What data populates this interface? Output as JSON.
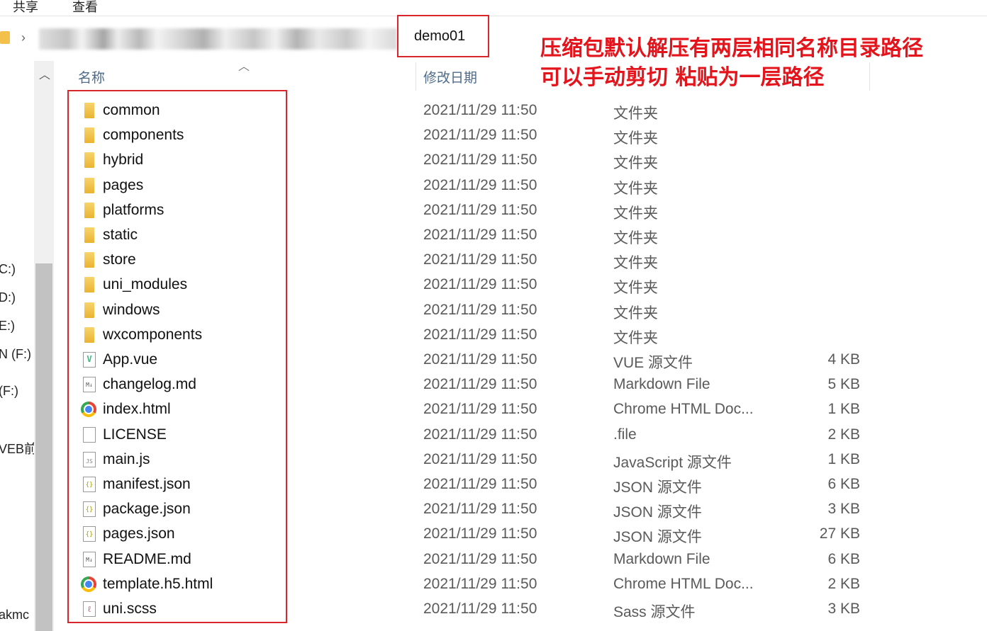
{
  "ribbon": {
    "share": "共享",
    "view": "查看"
  },
  "address": {
    "current_folder": "demo01"
  },
  "annotation": {
    "line1": "压缩包默认解压有两层相同名称目录路径",
    "line2": "可以手动剪切 粘贴为一层路径"
  },
  "nav": {
    "c": "C:)",
    "d": "D:)",
    "e": "E:)",
    "f1": "N (F:)",
    "f2": "(F:)",
    "web": "VEB前",
    "bottom": "akmc"
  },
  "columns": {
    "name": "名称",
    "date": "修改日期"
  },
  "files": [
    {
      "name": "common",
      "date": "2021/11/29 11:50",
      "type": "文件夹",
      "size": "",
      "icon": "folder-icon"
    },
    {
      "name": "components",
      "date": "2021/11/29 11:50",
      "type": "文件夹",
      "size": "",
      "icon": "folder-icon"
    },
    {
      "name": "hybrid",
      "date": "2021/11/29 11:50",
      "type": "文件夹",
      "size": "",
      "icon": "folder-icon"
    },
    {
      "name": "pages",
      "date": "2021/11/29 11:50",
      "type": "文件夹",
      "size": "",
      "icon": "folder-icon"
    },
    {
      "name": "platforms",
      "date": "2021/11/29 11:50",
      "type": "文件夹",
      "size": "",
      "icon": "folder-icon"
    },
    {
      "name": "static",
      "date": "2021/11/29 11:50",
      "type": "文件夹",
      "size": "",
      "icon": "folder-icon"
    },
    {
      "name": "store",
      "date": "2021/11/29 11:50",
      "type": "文件夹",
      "size": "",
      "icon": "folder-icon"
    },
    {
      "name": "uni_modules",
      "date": "2021/11/29 11:50",
      "type": "文件夹",
      "size": "",
      "icon": "folder-icon"
    },
    {
      "name": "windows",
      "date": "2021/11/29 11:50",
      "type": "文件夹",
      "size": "",
      "icon": "folder-icon"
    },
    {
      "name": "wxcomponents",
      "date": "2021/11/29 11:50",
      "type": "文件夹",
      "size": "",
      "icon": "folder-icon"
    },
    {
      "name": "App.vue",
      "date": "2021/11/29 11:50",
      "type": "VUE 源文件",
      "size": "4 KB",
      "icon": "vue-file-icon"
    },
    {
      "name": "changelog.md",
      "date": "2021/11/29 11:50",
      "type": "Markdown File",
      "size": "5 KB",
      "icon": "markdown-file-icon"
    },
    {
      "name": "index.html",
      "date": "2021/11/29 11:50",
      "type": "Chrome HTML Doc...",
      "size": "1 KB",
      "icon": "chrome-icon"
    },
    {
      "name": "LICENSE",
      "date": "2021/11/29 11:50",
      "type": ".file",
      "size": "2 KB",
      "icon": "blank-file-icon"
    },
    {
      "name": "main.js",
      "date": "2021/11/29 11:50",
      "type": "JavaScript 源文件",
      "size": "1 KB",
      "icon": "js-file-icon"
    },
    {
      "name": "manifest.json",
      "date": "2021/11/29 11:50",
      "type": "JSON 源文件",
      "size": "6 KB",
      "icon": "json-file-icon"
    },
    {
      "name": "package.json",
      "date": "2021/11/29 11:50",
      "type": "JSON 源文件",
      "size": "3 KB",
      "icon": "json-file-icon"
    },
    {
      "name": "pages.json",
      "date": "2021/11/29 11:50",
      "type": "JSON 源文件",
      "size": "27 KB",
      "icon": "json-file-icon"
    },
    {
      "name": "README.md",
      "date": "2021/11/29 11:50",
      "type": "Markdown File",
      "size": "6 KB",
      "icon": "markdown-file-icon"
    },
    {
      "name": "template.h5.html",
      "date": "2021/11/29 11:50",
      "type": "Chrome HTML Doc...",
      "size": "2 KB",
      "icon": "chrome-icon"
    },
    {
      "name": "uni.scss",
      "date": "2021/11/29 11:50",
      "type": "Sass 源文件",
      "size": "3 KB",
      "icon": "scss-file-icon"
    }
  ],
  "colors": {
    "highlight_red": "#d9262c",
    "annotation_red": "#e3141b",
    "folder_yellow": "#eab331"
  }
}
